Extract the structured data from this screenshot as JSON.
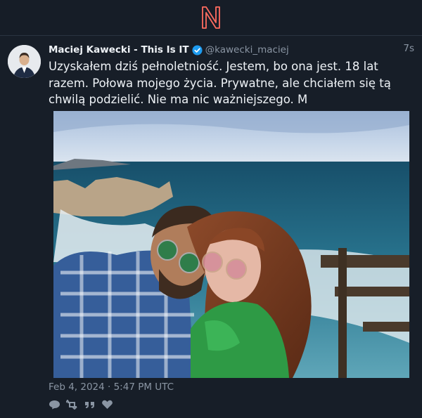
{
  "app": {
    "logo": "nitter-logo"
  },
  "tweet": {
    "display_name": "Maciej Kawecki - This Is IT",
    "username": "@kawecki_maciej",
    "time_ago": "7s",
    "text": "Uzyskałem dziś pełnoletniość. Jestem, bo ona jest. 18 lat razem. Połowa mojego życia. Prywatne, ale chciałem się tą chwilą podzielić. Nie ma nic ważniejszego. M",
    "date": "Feb 4, 2024 · 5:47 PM UTC",
    "actions": [
      "reply-icon",
      "retweet-icon",
      "quote-icon",
      "like-icon"
    ]
  },
  "colors": {
    "accent": "#ff6c60",
    "verified": "#1d9bf0",
    "background": "#161d27"
  }
}
